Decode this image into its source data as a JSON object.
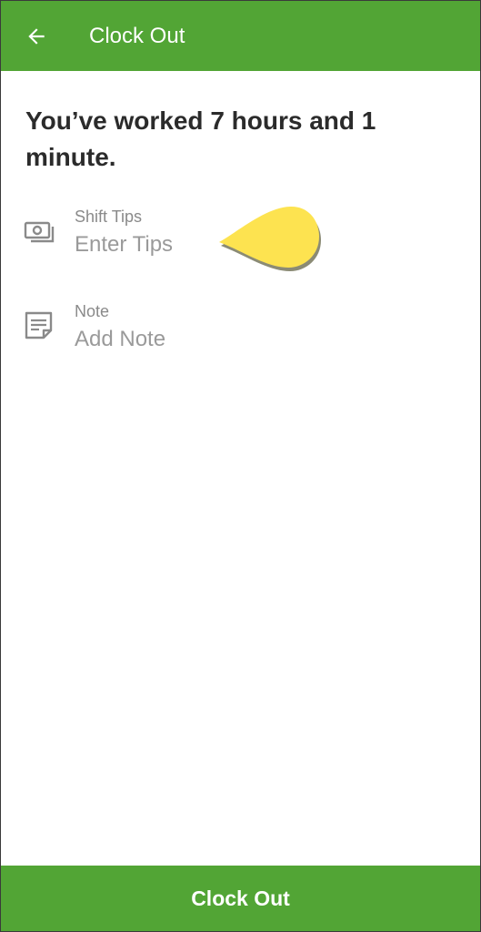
{
  "app_bar": {
    "title": "Clock Out",
    "back_icon": "arrow-left-icon",
    "background": "#52a535"
  },
  "summary": {
    "headline": "You’ve worked 7 hours and 1 minute."
  },
  "fields": {
    "tips": {
      "icon": "money-icon",
      "label": "Shift Tips",
      "placeholder": "Enter Tips"
    },
    "note": {
      "icon": "note-icon",
      "label": "Note",
      "placeholder": "Add Note"
    }
  },
  "footer": {
    "clock_out_label": "Clock Out"
  },
  "colors": {
    "primary": "#52a535",
    "touch_marker": "#fde350"
  }
}
